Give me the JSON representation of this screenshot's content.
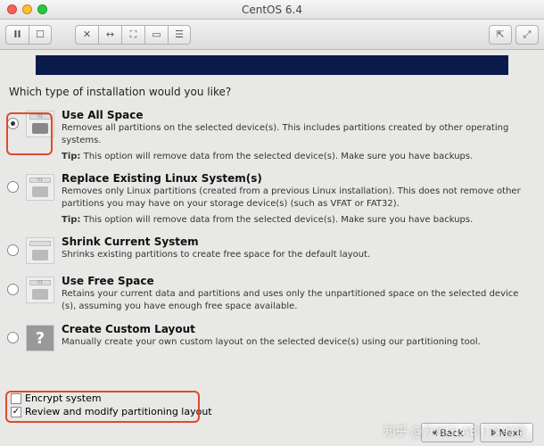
{
  "window": {
    "title": "CentOS 6.4"
  },
  "prompt": "Which type of installation would you like?",
  "options": [
    {
      "title": "Use All Space",
      "desc": "Removes all partitions on the selected device(s).  This includes partitions created by other operating systems.",
      "tip_label": "Tip:",
      "tip": "This option will remove data from the selected device(s).  Make sure you have backups.",
      "selected": true
    },
    {
      "title": "Replace Existing Linux System(s)",
      "desc": "Removes only Linux partitions (created from a previous Linux installation).  This does not remove other partitions you may have on your storage device(s) (such as VFAT or FAT32).",
      "tip_label": "Tip:",
      "tip": "This option will remove data from the selected device(s).  Make sure you have backups.",
      "selected": false
    },
    {
      "title": "Shrink Current System",
      "desc": "Shrinks existing partitions to create free space for the default layout.",
      "selected": false
    },
    {
      "title": "Use Free Space",
      "desc": "Retains your current data and partitions and uses only the unpartitioned space on the selected device (s), assuming you have enough free space available.",
      "selected": false
    },
    {
      "title": "Create Custom Layout",
      "desc": "Manually create your own custom layout on the selected device(s) using our partitioning tool.",
      "selected": false
    }
  ],
  "checkboxes": {
    "encrypt": {
      "label": "Encrypt system",
      "checked": false
    },
    "review": {
      "label": "Review and modify partitioning layout",
      "checked": true
    }
  },
  "nav": {
    "back": "Back",
    "next": "Next"
  },
  "watermark": "知乎 @苏州GLAB IT实验室"
}
